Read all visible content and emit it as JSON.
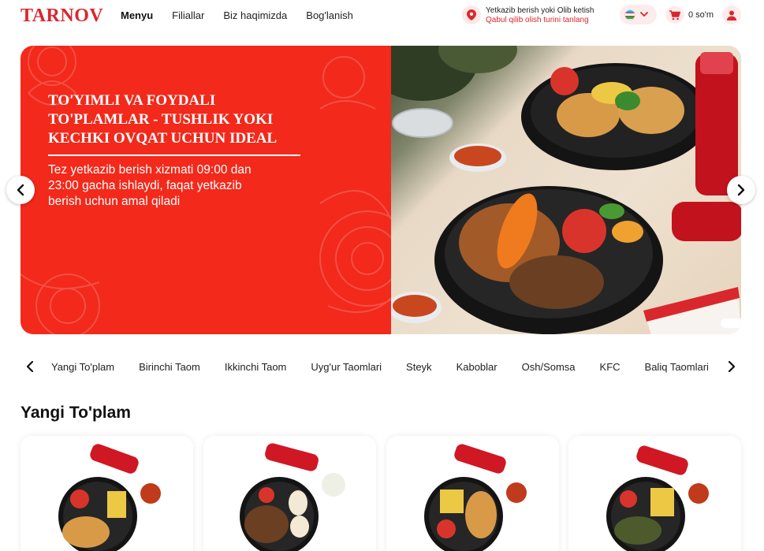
{
  "header": {
    "logo_text": "TARNOV",
    "nav": [
      {
        "label": "Menyu",
        "active": true
      },
      {
        "label": "Filiallar",
        "active": false
      },
      {
        "label": "Biz haqimizda",
        "active": false
      },
      {
        "label": "Bog'lanish",
        "active": false
      }
    ],
    "delivery_title": "Yetkazib berish yoki Olib ketish",
    "delivery_subtitle": "Qabul qilib olish turini tanlang",
    "language_icon": "uzbekistan-flag-icon",
    "cart_total": "0 so'm"
  },
  "banner": {
    "title": "To'yimli va foydali to'plamlar - tushlik yoki kechki ovqat uchun ideal",
    "text": "Tez yetkazib berish xizmati 09:00 dan 23:00 gacha ishlaydi, faqat yetkazib berish uchun amal qiladi",
    "slide_active": 1,
    "slide_count": 3
  },
  "categories": [
    "Yangi To'plam",
    "Birinchi Taom",
    "Ikkinchi Taom",
    "Uyg'ur Taomlari",
    "Steyk",
    "Kaboblar",
    "Osh/Somsa",
    "KFC",
    "Baliq Taomlari"
  ],
  "section": {
    "title": "Yangi To'plam"
  },
  "colors": {
    "brand_red": "#d9272e",
    "banner_red": "#f2291b",
    "pill_bg": "#fdecec"
  }
}
